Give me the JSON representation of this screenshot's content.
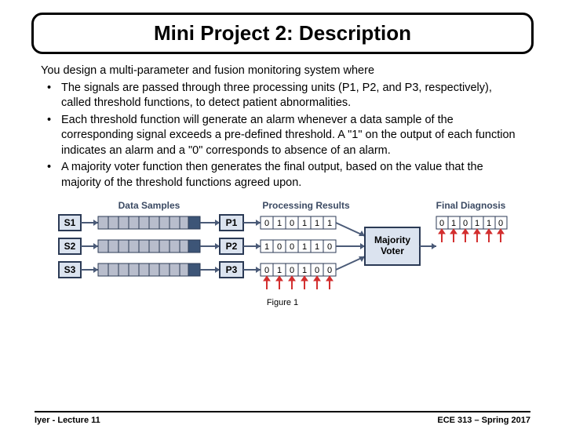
{
  "title": "Mini Project 2: Description",
  "intro": "You design a multi-parameter and fusion monitoring system where",
  "bullets": [
    "The signals are passed through three processing units (P1, P2, and P3, respectively), called threshold functions, to detect patient abnormalities.",
    "Each threshold function will generate an alarm whenever a data sample of the corresponding signal exceeds a pre-defined threshold. A \"1\" on the output of each function indicates an alarm and a \"0\" corresponds to absence of an alarm.",
    "A majority voter function then generates the final output, based on the value that the majority of the threshold functions agreed upon."
  ],
  "diagram": {
    "header_samples": "Data Samples",
    "header_results": "Processing Results",
    "header_final": "Final Diagnosis",
    "signals": [
      "S1",
      "S2",
      "S3"
    ],
    "processors": [
      "P1",
      "P2",
      "P3"
    ],
    "results": [
      [
        "0",
        "1",
        "0",
        "1",
        "1",
        "1"
      ],
      [
        "1",
        "0",
        "0",
        "1",
        "1",
        "0"
      ],
      [
        "0",
        "1",
        "0",
        "1",
        "0",
        "0"
      ]
    ],
    "voter_label": "Majority Voter",
    "final": [
      "0",
      "1",
      "0",
      "1",
      "1",
      "0"
    ]
  },
  "figure_caption": "Figure 1",
  "footer_left": "Iyer - Lecture 11",
  "footer_right": "ECE 313 – Spring 2017"
}
